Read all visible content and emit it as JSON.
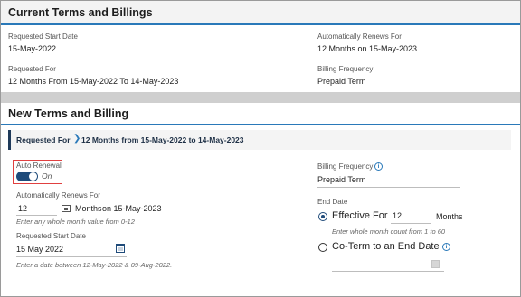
{
  "current": {
    "title": "Current Terms and Billings",
    "requested_start_date_label": "Requested Start Date",
    "requested_start_date_value": "15-May-2022",
    "auto_renews_label": "Automatically Renews For",
    "auto_renews_value": "12 Months on 15-May-2023",
    "requested_for_label": "Requested For",
    "requested_for_value": "12 Months From 15-May-2022 To 14-May-2023",
    "billing_frequency_label": "Billing Frequency",
    "billing_frequency_value": "Prepaid Term"
  },
  "new": {
    "title": "New Terms and Billing",
    "requested_for_label": "Requested For",
    "requested_for_value": "12 Months from 15-May-2022 to 14-May-2023",
    "auto_renewal_label": "Auto Renewal",
    "auto_renewal_state": "On",
    "auto_renews_label": "Automatically Renews For",
    "auto_renews_input": "12",
    "auto_renews_suffix_months": "Months",
    "auto_renews_suffix_on": "on 15-May-2023",
    "auto_renews_hint": "Enter any whole month value from 0-12",
    "requested_start_date_label": "Requested Start Date",
    "requested_start_date_value": "15 May 2022",
    "requested_start_date_hint": "Enter a date between 12-May-2022 & 09-Aug-2022.",
    "billing_frequency_label": "Billing Frequency",
    "billing_frequency_value": "Prepaid Term",
    "end_date_label": "End Date",
    "effective_for_label": "Effective For",
    "effective_for_value": "12",
    "effective_for_unit": "Months",
    "effective_for_hint": "Enter whole month count from 1 to 60",
    "co_term_label": "Co-Term to an End Date"
  },
  "icons": {
    "chevron": "chevron-right-icon",
    "info": "info-icon",
    "calendar": "calendar-icon"
  },
  "colors": {
    "accent": "#2a79b9",
    "toggle_on": "#1f4b7a",
    "highlight_border": "#e04040"
  }
}
